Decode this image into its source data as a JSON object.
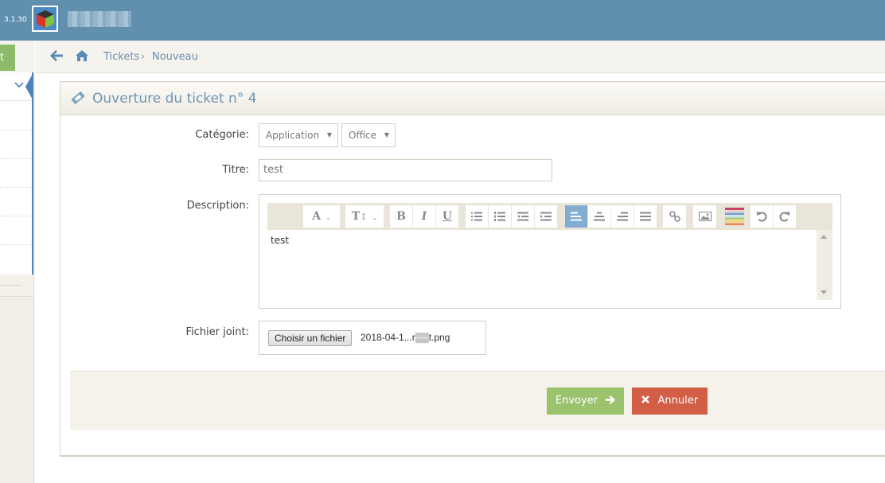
{
  "navbar": {
    "version": "3.1.30",
    "brand_icon": "cube-logo-icon",
    "brand_name_blurred": true
  },
  "sidebar": {
    "button_label": "t",
    "menu_chevron": "chevron-down-icon"
  },
  "breadcrumb": {
    "back_icon": "arrow-left-icon",
    "home_icon": "home-icon",
    "items": [
      "Tickets",
      "Nouveau"
    ],
    "separator": "›"
  },
  "form": {
    "title": "Ouverture du ticket n° 4",
    "title_icon": "ticket-icon",
    "category": {
      "label": "Catégorie:",
      "select_1": "Application",
      "select_2": "Office"
    },
    "title_field": {
      "label": "Titre:",
      "value": "test"
    },
    "description": {
      "label": "Description:",
      "content": "test",
      "toolbar": [
        {
          "name": "font-family",
          "label": "A",
          "icon": "font-icon",
          "dropdown": true
        },
        {
          "name": "font-size",
          "label": "TI",
          "icon": "text-height-icon",
          "dropdown": true
        },
        {
          "name": "bold",
          "label": "B",
          "icon": "bold-icon"
        },
        {
          "name": "italic",
          "label": "I",
          "icon": "italic-icon"
        },
        {
          "name": "underline",
          "label": "U",
          "icon": "underline-icon"
        },
        {
          "name": "bullet-list",
          "icon": "list-ul-icon"
        },
        {
          "name": "numbered-list",
          "icon": "list-ol-icon"
        },
        {
          "name": "outdent",
          "icon": "outdent-icon"
        },
        {
          "name": "indent",
          "icon": "indent-icon"
        },
        {
          "name": "align-left",
          "icon": "align-left-icon",
          "active": true
        },
        {
          "name": "align-center",
          "icon": "align-center-icon"
        },
        {
          "name": "align-right",
          "icon": "align-right-icon"
        },
        {
          "name": "justify",
          "icon": "align-justify-icon"
        },
        {
          "name": "link",
          "icon": "link-icon"
        },
        {
          "name": "image",
          "icon": "image-icon"
        },
        {
          "name": "color",
          "icon": "color-palette-icon"
        },
        {
          "name": "undo",
          "icon": "undo-icon"
        },
        {
          "name": "redo",
          "icon": "redo-icon"
        }
      ]
    },
    "attachment": {
      "label": "Fichier joint:",
      "button_label": "Choisir un fichier",
      "file_name": "2018-04-1...r▒▒t.png"
    },
    "actions": {
      "send_label": "Envoyer",
      "send_icon": "arrow-right-icon",
      "cancel_label": "Annuler",
      "cancel_icon": "times-icon"
    }
  },
  "colors": {
    "navbar": "#6190af",
    "accent_blue": "#4f83bd",
    "title_blue": "#6f96b3",
    "send_green": "#9bc26d",
    "cancel_red": "#d15e45",
    "active_tool": "#83acd3"
  }
}
